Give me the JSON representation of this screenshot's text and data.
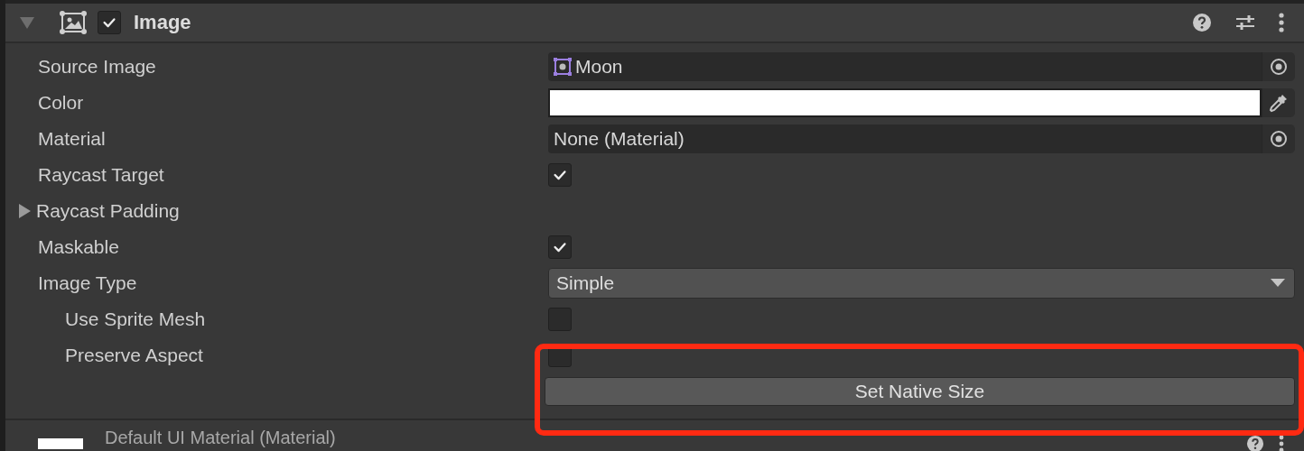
{
  "component": {
    "title": "Image",
    "enabled": true,
    "expanded": true
  },
  "properties": [
    {
      "kind": "object",
      "label": "Source Image",
      "value": "Moon",
      "has_asset_icon": true
    },
    {
      "kind": "color",
      "label": "Color",
      "color": "#ffffff"
    },
    {
      "kind": "object",
      "label": "Material",
      "value": "None (Material)",
      "has_asset_icon": false
    },
    {
      "kind": "checkbox",
      "label": "Raycast Target",
      "checked": true
    },
    {
      "kind": "foldout",
      "label": "Raycast Padding",
      "expanded": false
    },
    {
      "kind": "checkbox",
      "label": "Maskable",
      "checked": true
    },
    {
      "kind": "dropdown",
      "label": "Image Type",
      "value": "Simple",
      "children": [
        {
          "kind": "checkbox",
          "label": "Use Sprite Mesh",
          "checked": false
        },
        {
          "kind": "checkbox",
          "label": "Preserve Aspect",
          "checked": false
        }
      ]
    },
    {
      "kind": "button",
      "label": "Set Native Size"
    }
  ],
  "material_preview": {
    "name": "Default UI Material (Material)"
  },
  "highlight_box": true
}
